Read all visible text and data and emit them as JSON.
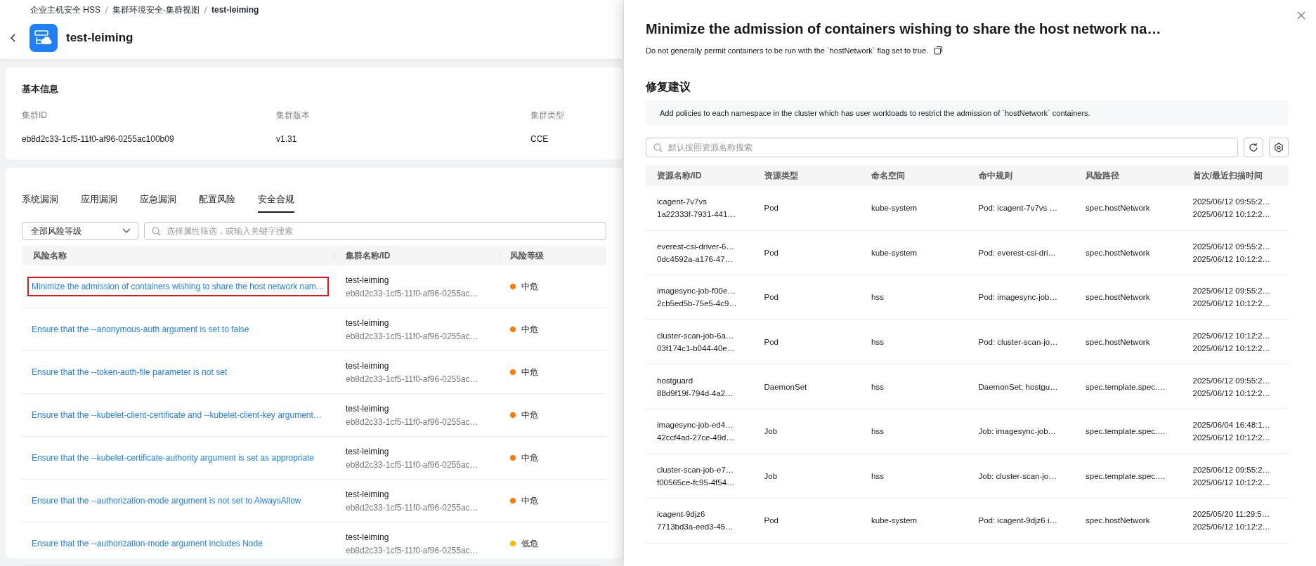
{
  "breadcrumb": [
    "企业主机安全 HSS",
    "集群环境安全-集群视图",
    "test-leiming"
  ],
  "page_title": "test-leiming",
  "basic_info": {
    "title": "基本信息",
    "fields": [
      {
        "label": "集群ID",
        "value": "eb8d2c33-1cf5-11f0-af96-0255ac100b09"
      },
      {
        "label": "集群版本",
        "value": "v1.31"
      },
      {
        "label": "集群类型",
        "value": "CCE"
      }
    ]
  },
  "tabs": [
    {
      "label": "系统漏洞",
      "selected": false
    },
    {
      "label": "应用漏洞",
      "selected": false
    },
    {
      "label": "应急漏洞",
      "selected": false
    },
    {
      "label": "配置风险",
      "selected": false
    },
    {
      "label": "安全合规",
      "selected": true
    }
  ],
  "filter": {
    "level_select": "全部风险等级",
    "search_placeholder": "选择属性筛选，或输入关键字搜索"
  },
  "risk_table": {
    "columns": [
      "风险名称",
      "集群名称/ID",
      "风险等级"
    ],
    "rows": [
      {
        "name": "Minimize the admission of containers wishing to share the host network nam…",
        "cluster": "test-leiming",
        "cluster_id": "eb8d2c33-1cf5-11f0-af96-0255ac…",
        "level": "中危",
        "color": "#ff7d00",
        "highlighted": true
      },
      {
        "name": "Ensure that the --anonymous-auth argument is set to false",
        "cluster": "test-leiming",
        "cluster_id": "eb8d2c33-1cf5-11f0-af96-0255ac…",
        "level": "中危",
        "color": "#ff7d00",
        "highlighted": false
      },
      {
        "name": "Ensure that the --token-auth-file parameter is not set",
        "cluster": "test-leiming",
        "cluster_id": "eb8d2c33-1cf5-11f0-af96-0255ac…",
        "level": "中危",
        "color": "#ff7d00",
        "highlighted": false
      },
      {
        "name": "Ensure that the --kubelet-client-certificate and --kubelet-client-key argument…",
        "cluster": "test-leiming",
        "cluster_id": "eb8d2c33-1cf5-11f0-af96-0255ac…",
        "level": "中危",
        "color": "#ff7d00",
        "highlighted": false
      },
      {
        "name": "Ensure that the --kubelet-certificate-authority argument is set as appropriate",
        "cluster": "test-leiming",
        "cluster_id": "eb8d2c33-1cf5-11f0-af96-0255ac…",
        "level": "中危",
        "color": "#ff7d00",
        "highlighted": false
      },
      {
        "name": "Ensure that the --authorization-mode argument is not set to AlwaysAllow",
        "cluster": "test-leiming",
        "cluster_id": "eb8d2c33-1cf5-11f0-af96-0255ac…",
        "level": "中危",
        "color": "#ff7d00",
        "highlighted": false
      },
      {
        "name": "Ensure that the --authorization-mode argument includes Node",
        "cluster": "test-leiming",
        "cluster_id": "eb8d2c33-1cf5-11f0-af96-0255ac…",
        "level": "低危",
        "color": "#ffb800",
        "highlighted": false
      }
    ]
  },
  "drawer": {
    "title": "Minimize the admission of containers wishing to share the host network na…",
    "description": "Do not generally permit containers to be run with the `hostNetwork` flag set to true.",
    "advice_title": "修复建议",
    "advice": "Add policies to each namespace in the cluster which has user workloads to restrict the admission of `hostNetwork` containers.",
    "search_placeholder": "默认按照资源名称搜索",
    "columns": [
      "资源名称/ID",
      "资源类型",
      "命名空间",
      "命中规则",
      "风险路径",
      "首次/最近扫描时间"
    ],
    "rows": [
      {
        "name": "icagent-7v7vs",
        "id": "1a22333f-7931-441…",
        "type": "Pod",
        "namespace": "kube-system",
        "rule": "Pod: icagent-7v7vs …",
        "path": "spec.hostNetwork",
        "first_scan": "2025/06/12 09:55:2…",
        "last_scan": "2025/06/12 10:12:2…"
      },
      {
        "name": "everest-csi-driver-6…",
        "id": "0dc4592a-a176-47…",
        "type": "Pod",
        "namespace": "kube-system",
        "rule": "Pod: everest-csi-dri…",
        "path": "spec.hostNetwork",
        "first_scan": "2025/06/12 09:55:2…",
        "last_scan": "2025/06/12 10:12:2…"
      },
      {
        "name": "imagesync-job-f00e…",
        "id": "2cb5ed5b-75e5-4c9…",
        "type": "Pod",
        "namespace": "hss",
        "rule": "Pod: imagesync-job…",
        "path": "spec.hostNetwork",
        "first_scan": "2025/06/12 09:55:2…",
        "last_scan": "2025/06/12 10:12:2…"
      },
      {
        "name": "cluster-scan-job-6a…",
        "id": "03f174c1-b044-40e…",
        "type": "Pod",
        "namespace": "hss",
        "rule": "Pod: cluster-scan-jo…",
        "path": "spec.hostNetwork",
        "first_scan": "2025/06/12 10:12:2…",
        "last_scan": "2025/06/12 10:12:2…"
      },
      {
        "name": "hostguard",
        "id": "88d9f19f-794d-4a2…",
        "type": "DaemonSet",
        "namespace": "hss",
        "rule": "DaemonSet: hostgu…",
        "path": "spec.template.spec.…",
        "first_scan": "2025/06/12 09:55:2…",
        "last_scan": "2025/06/12 10:12:2…"
      },
      {
        "name": "imagesync-job-ed4…",
        "id": "42ccf4ad-27ce-49d…",
        "type": "Job",
        "namespace": "hss",
        "rule": "Job: imagesync-job…",
        "path": "spec.template.spec.…",
        "first_scan": "2025/06/04 16:48:1…",
        "last_scan": "2025/06/12 10:12:2…"
      },
      {
        "name": "cluster-scan-job-e7…",
        "id": "f00565ce-fc95-4f54…",
        "type": "Job",
        "namespace": "hss",
        "rule": "Job: cluster-scan-jo…",
        "path": "spec.template.spec.…",
        "first_scan": "2025/06/12 09:55:2…",
        "last_scan": "2025/06/12 10:12:2…"
      },
      {
        "name": "icagent-9djz6",
        "id": "7713bd3a-eed3-45…",
        "type": "Pod",
        "namespace": "kube-system",
        "rule": "Pod: icagent-9djz6 i…",
        "path": "spec.hostNetwork",
        "first_scan": "2025/05/20 11:29:5…",
        "last_scan": "2025/06/12 10:12:2…"
      }
    ]
  }
}
